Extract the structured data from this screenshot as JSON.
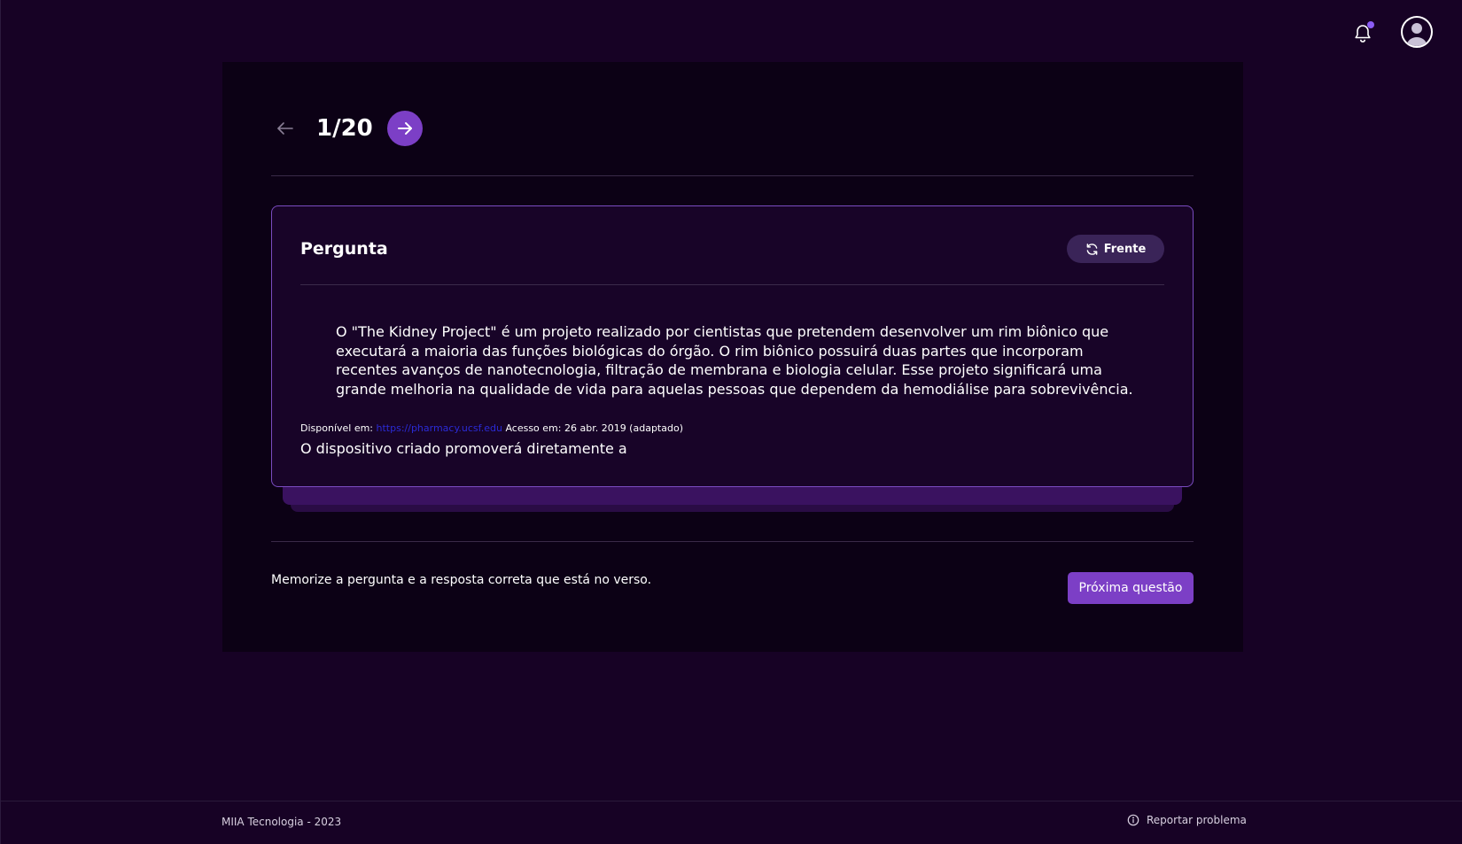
{
  "header": {
    "notification_icon": "bell-icon",
    "notification_dot_color": "#8b5cf6",
    "avatar_icon": "user-avatar-icon"
  },
  "navigation": {
    "prev_icon": "arrow-left-icon",
    "counter": "1/20",
    "next_icon": "arrow-right-icon",
    "accent_color": "#7c3fc6"
  },
  "card": {
    "title": "Pergunta",
    "flip_label": "Frente",
    "flip_icon": "refresh-icon",
    "quote": "O \"The Kidney Project\" é um projeto realizado por cientistas que pretendem desenvolver um rim biônico que executará a maioria das funções biológicas do órgão. O rim biônico possuirá duas partes que incorporam recentes avanços de nanotecnologia, filtração de membrana e biologia celular. Esse projeto significará uma grande melhoria na qualidade de vida para aquelas pessoas que dependem da hemodiálise para sobrevivência.",
    "source_prefix": "Disponível em: ",
    "source_link": "https://pharmacy.ucsf.edu",
    "source_suffix": " Acesso em: 26 abr. 2019 (adaptado)",
    "question": "O dispositivo criado promoverá diretamente a"
  },
  "footer_actions": {
    "hint": "Memorize a pergunta e a resposta correta que está no verso.",
    "next_button": "Próxima questão"
  },
  "footer": {
    "copyright": "MIIA Tecnologia - 2023",
    "report_label": "Reportar problema",
    "report_icon": "info-icon"
  }
}
